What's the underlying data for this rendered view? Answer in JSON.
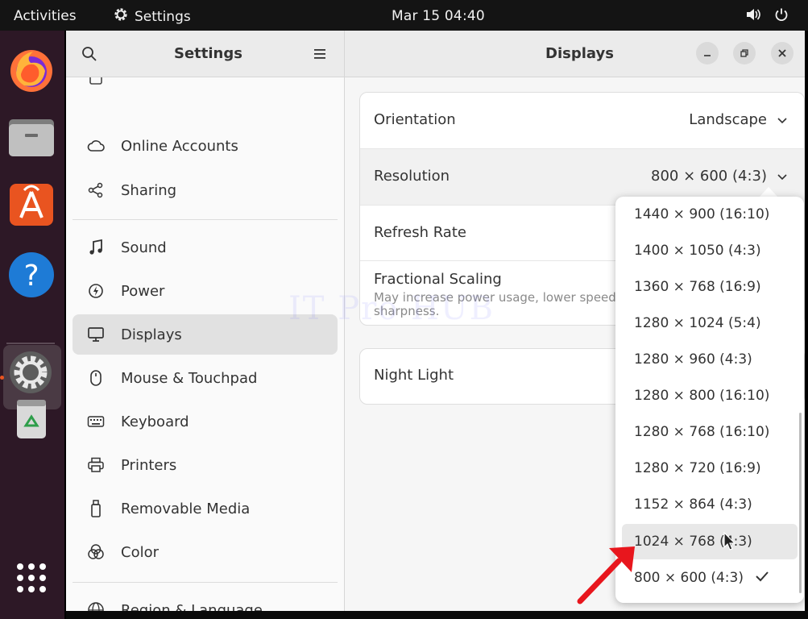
{
  "topbar": {
    "activities": "Activities",
    "app_name": "Settings",
    "clock": "Mar 15  04:40"
  },
  "dock": {
    "apps": [
      "firefox",
      "files",
      "app-center",
      "help",
      "settings",
      "trash",
      "show-apps"
    ]
  },
  "sidebar": {
    "title": "Settings",
    "items": [
      {
        "label": "Online Accounts",
        "icon": "cloud-icon"
      },
      {
        "label": "Sharing",
        "icon": "share-icon"
      },
      {
        "label": "Sound",
        "icon": "music-note-icon"
      },
      {
        "label": "Power",
        "icon": "power-icon"
      },
      {
        "label": "Displays",
        "icon": "monitor-icon"
      },
      {
        "label": "Mouse & Touchpad",
        "icon": "mouse-icon"
      },
      {
        "label": "Keyboard",
        "icon": "keyboard-icon"
      },
      {
        "label": "Printers",
        "icon": "printer-icon"
      },
      {
        "label": "Removable Media",
        "icon": "usb-icon"
      },
      {
        "label": "Color",
        "icon": "color-icon"
      },
      {
        "label": "Region & Language",
        "icon": "globe-icon"
      }
    ],
    "selected": "Displays"
  },
  "main": {
    "title": "Displays",
    "orientation": {
      "label": "Orientation",
      "value": "Landscape"
    },
    "resolution": {
      "label": "Resolution",
      "value": "800 × 600 (4:3)"
    },
    "refresh_rate": {
      "label": "Refresh Rate"
    },
    "fractional_scaling": {
      "label": "Fractional Scaling",
      "description_line1": "May increase power usage, lower speed, or",
      "description_line2": "sharpness."
    },
    "night_light": {
      "label": "Night Light"
    }
  },
  "resolution_options": [
    "1440 × 900 (16:10)",
    "1400 × 1050 (4:3)",
    "1360 × 768 (16:9)",
    "1280 × 1024 (5:4)",
    "1280 × 960 (4:3)",
    "1280 × 800 (16:10)",
    "1280 × 768 (16:10)",
    "1280 × 720 (16:9)",
    "1152 × 864 (4:3)",
    "1024 × 768 (4:3)",
    "800 × 600 (4:3)"
  ],
  "selected_resolution": "800 × 600 (4:3)",
  "hovered_resolution": "1024 × 768 (4:3)",
  "watermark": "IT Pro HUB",
  "colors": {
    "accent": "#e95420",
    "dock_bg": "#2d1826",
    "arrow": "#e8161d"
  }
}
